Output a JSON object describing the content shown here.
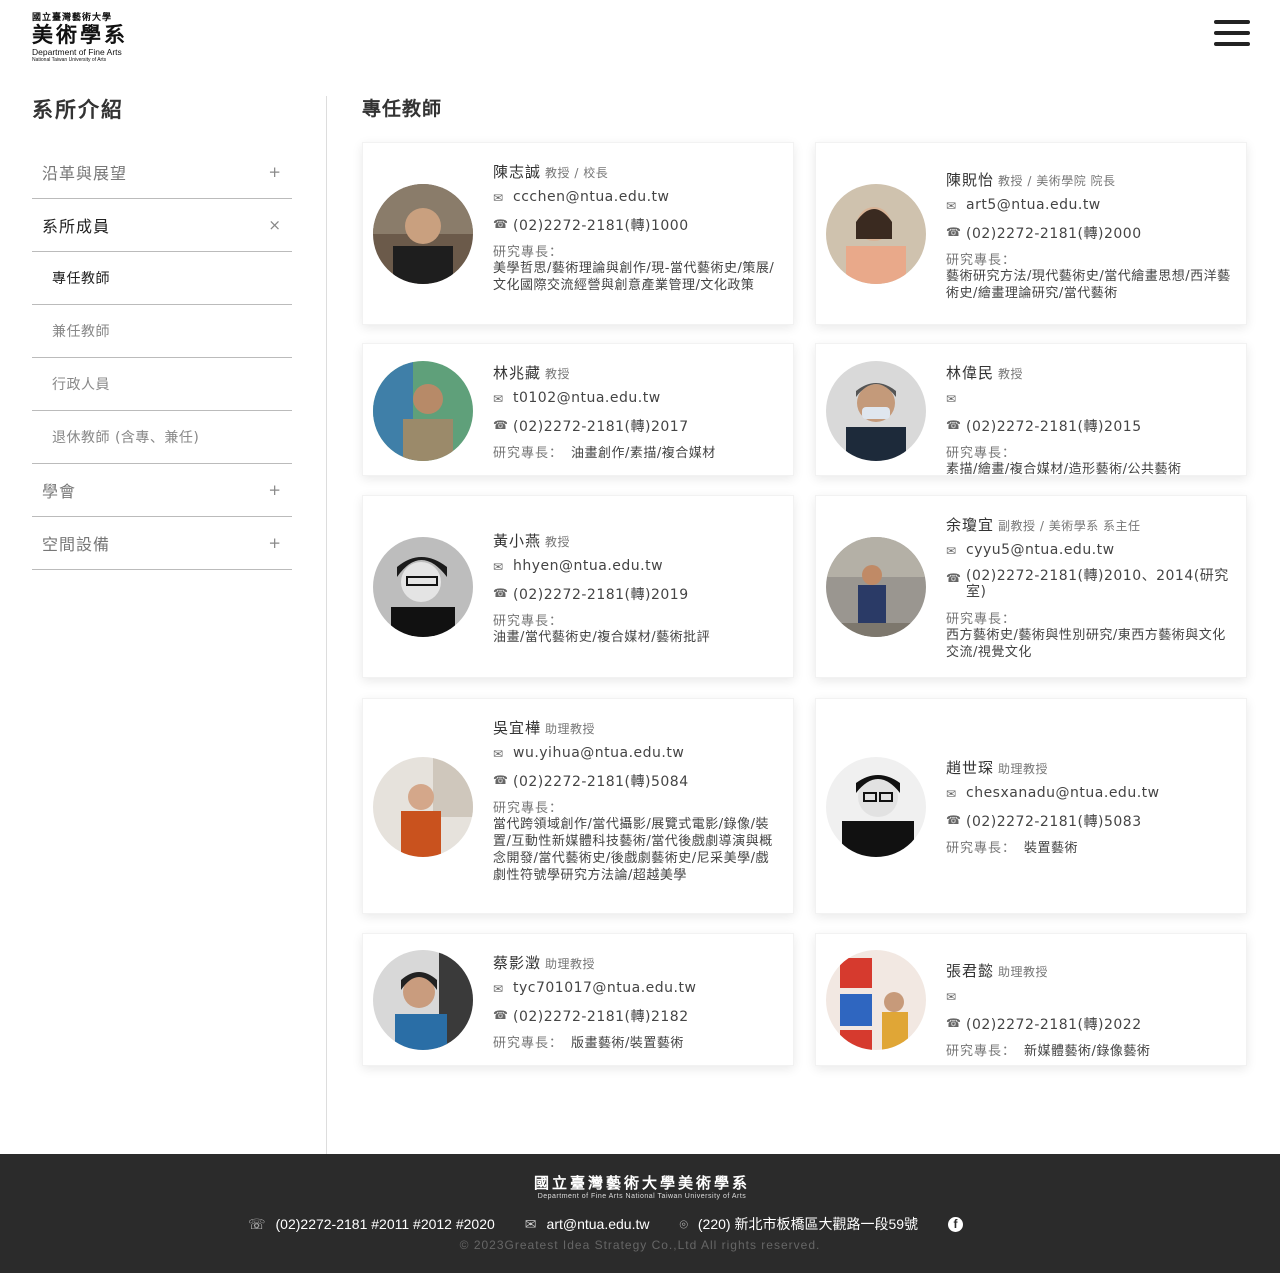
{
  "logo": {
    "line1": "國立臺灣藝術大學",
    "line2": "美術學系",
    "line3": "Department of Fine Arts",
    "line4": "National Taiwan University of Arts"
  },
  "sidebar": {
    "title": "系所介紹",
    "items": [
      {
        "label": "沿革與展望",
        "symbol": "+"
      },
      {
        "label": "系所成員",
        "symbol": "×"
      },
      {
        "label": "學會",
        "symbol": "+"
      },
      {
        "label": "空間設備",
        "symbol": "+"
      }
    ],
    "sub_items": [
      {
        "label": "專任教師"
      },
      {
        "label": "兼任教師"
      },
      {
        "label": "行政人員"
      },
      {
        "label": "退休教師 (含專、兼任)"
      }
    ]
  },
  "main": {
    "title": "專任教師",
    "spec_label": "研究專長：",
    "faculty": [
      {
        "name": "陳志誠",
        "title": "教授 / 校長",
        "email": "ccchen@ntua.edu.tw",
        "phone": "(02)2272-2181(轉)1000",
        "spec": "美學哲思/藝術理論與創作/現-當代藝術史/策展/文化國際交流經營與創意產業管理/文化政策"
      },
      {
        "name": "陳貺怡",
        "title": "教授 / 美術學院 院長",
        "email": "art5@ntua.edu.tw",
        "phone": "(02)2272-2181(轉)2000",
        "spec": "藝術研究方法/現代藝術史/當代繪畫思想/西洋藝術史/繪畫理論研究/當代藝術"
      },
      {
        "name": "林兆藏",
        "title": "教授",
        "email": "t0102@ntua.edu.tw",
        "phone": "(02)2272-2181(轉)2017",
        "spec": "油畫創作/素描/複合媒材"
      },
      {
        "name": "林偉民",
        "title": "教授",
        "email": "",
        "phone": "(02)2272-2181(轉)2015",
        "spec": "素描/繪畫/複合媒材/造形藝術/公共藝術"
      },
      {
        "name": "黃小燕",
        "title": "教授",
        "email": "hhyen@ntua.edu.tw",
        "phone": "(02)2272-2181(轉)2019",
        "spec": "油畫/當代藝術史/複合媒材/藝術批評"
      },
      {
        "name": "余瓊宜",
        "title": "副教授 / 美術學系 系主任",
        "email": "cyyu5@ntua.edu.tw",
        "phone": "(02)2272-2181(轉)2010、2014(研究室)",
        "spec": "西方藝術史/藝術與性別研究/東西方藝術與文化交流/視覺文化"
      },
      {
        "name": "吳宜樺",
        "title": "助理教授",
        "email": "wu.yihua@ntua.edu.tw",
        "phone": "(02)2272-2181(轉)5084",
        "spec": "當代跨領域創作/當代攝影/展覽式電影/錄像/裝置/互動性新媒體科技藝術/當代後戲劇導演與概念開發/當代藝術史/後戲劇藝術史/尼采美學/戲劇性符號學研究方法論/超越美學"
      },
      {
        "name": "趙世琛",
        "title": "助理教授",
        "email": "chesxanadu@ntua.edu.tw",
        "phone": "(02)2272-2181(轉)5083",
        "spec": "裝置藝術"
      },
      {
        "name": "蔡影澂",
        "title": "助理教授",
        "email": "tyc701017@ntua.edu.tw",
        "phone": "(02)2272-2181(轉)2182",
        "spec": "版畫藝術/裝置藝術"
      },
      {
        "name": "張君懿",
        "title": "助理教授",
        "email": "",
        "phone": "(02)2272-2181(轉)2022",
        "spec": "新媒體藝術/錄像藝術"
      }
    ]
  },
  "footer": {
    "logo_zh": "國立臺灣藝術大學美術學系",
    "logo_en": "Department of Fine Arts  National Taiwan University of Arts",
    "phone": "(02)2272-2181 #2011 #2012 #2020",
    "email": "art@ntua.edu.tw",
    "address": "(220) 新北市板橋區大觀路一段59號",
    "copyright": "© 2023Greatest Idea Strategy Co.,Ltd All rights reserved."
  },
  "icons": {
    "email": "envelope-icon",
    "phone": "phone-icon",
    "location": "location-pin-icon",
    "facebook": "facebook-icon",
    "menu": "hamburger-icon"
  }
}
